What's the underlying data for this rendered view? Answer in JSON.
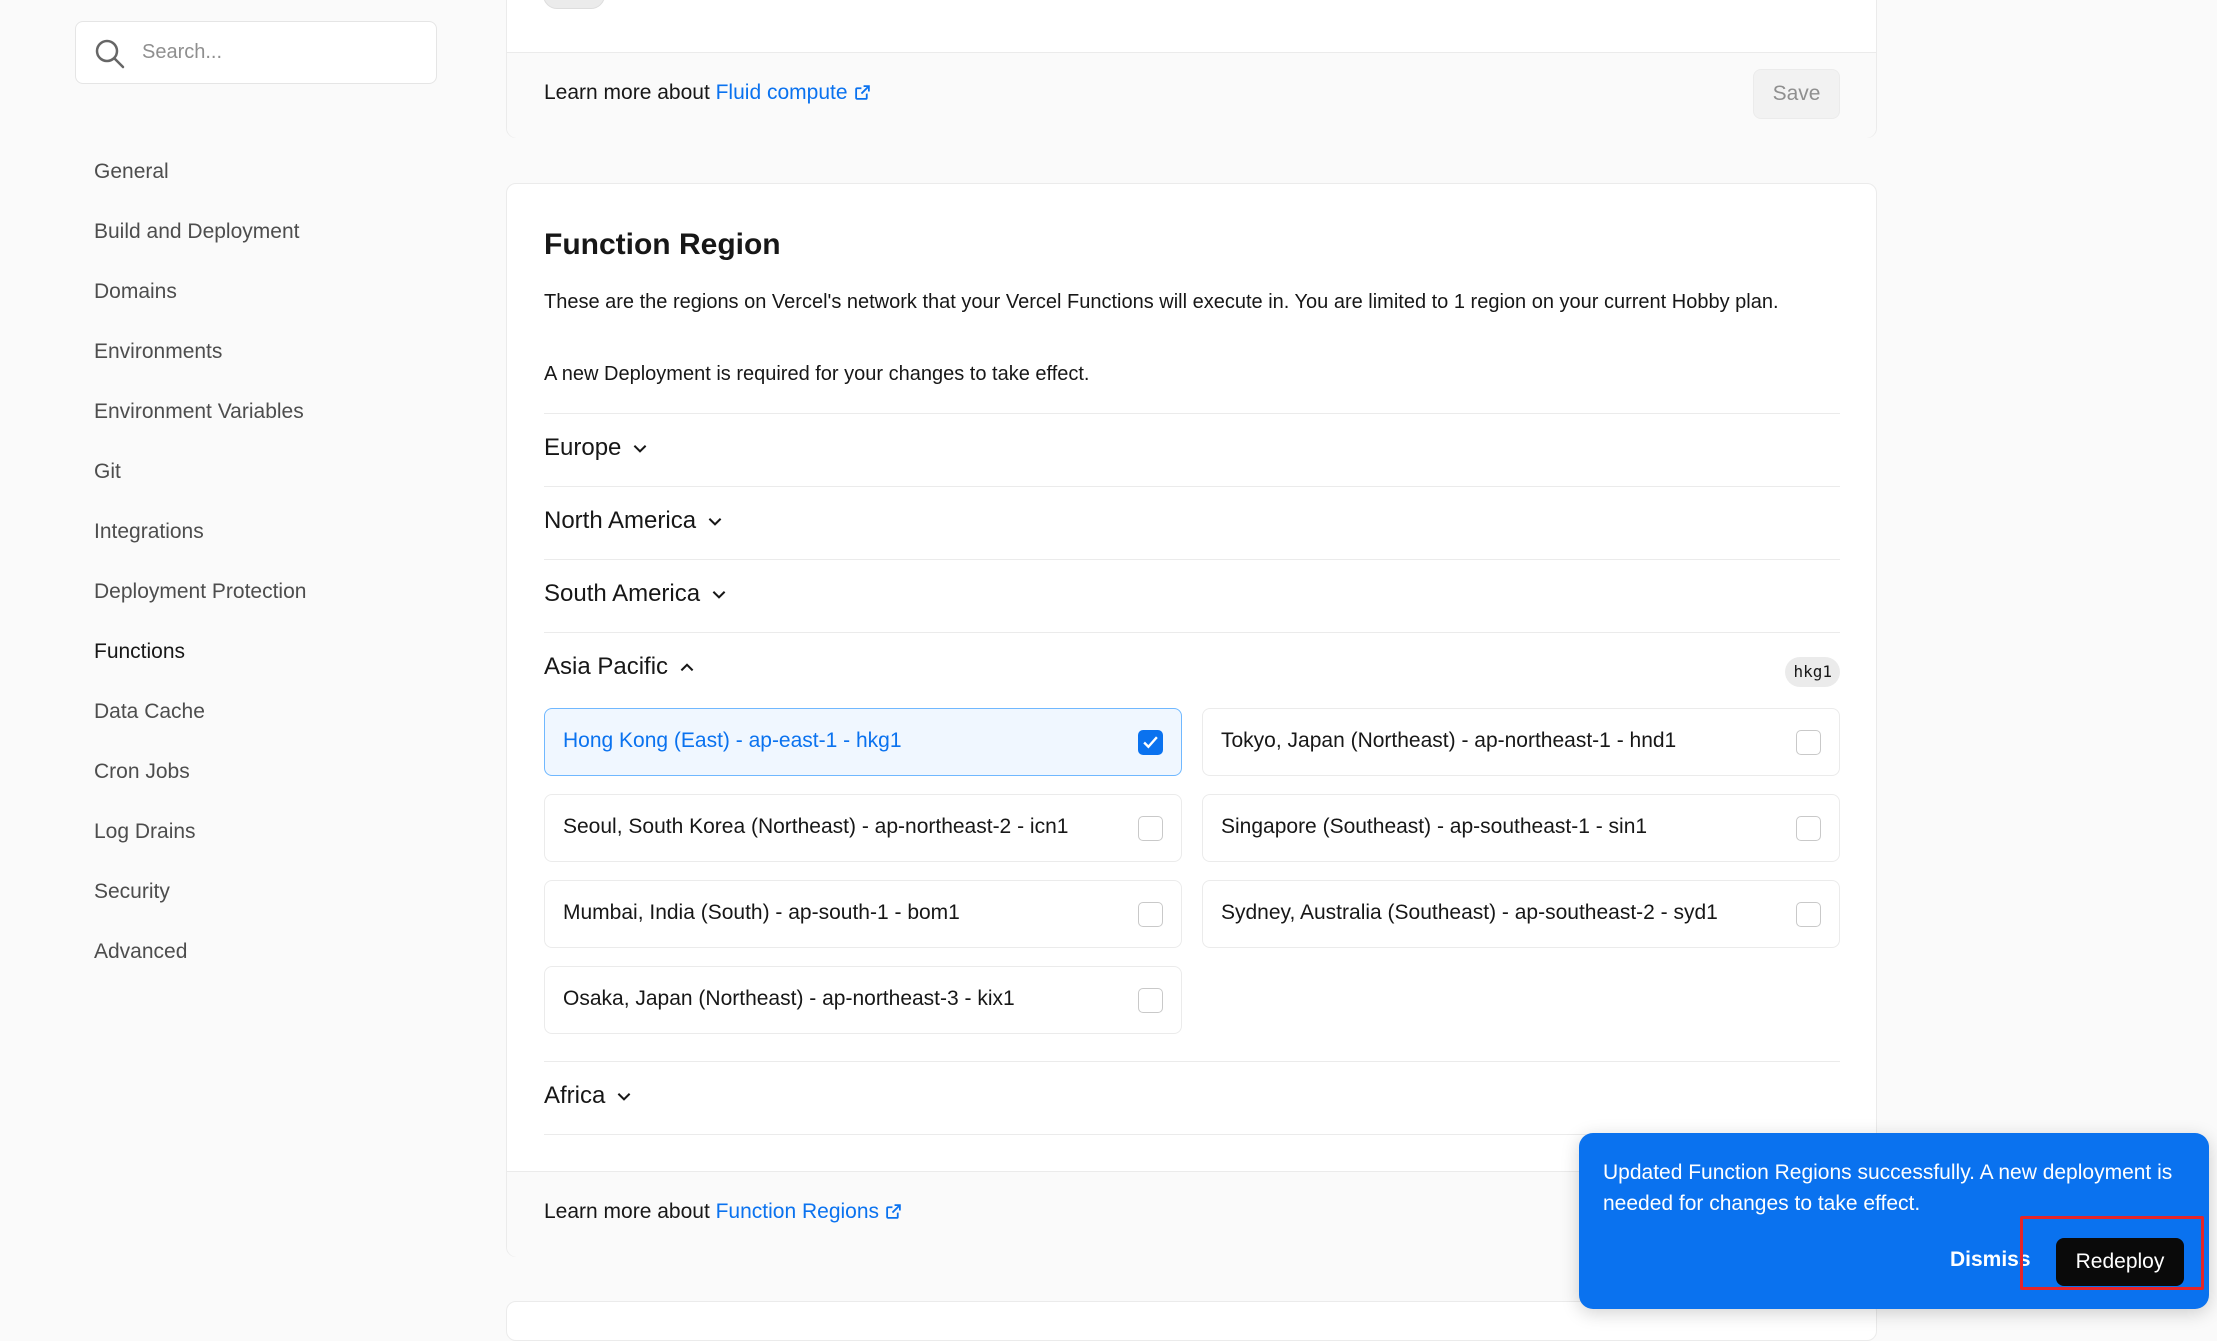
{
  "search": {
    "placeholder": "Search..."
  },
  "sidebar": {
    "items": [
      {
        "label": "General"
      },
      {
        "label": "Build and Deployment"
      },
      {
        "label": "Domains"
      },
      {
        "label": "Environments"
      },
      {
        "label": "Environment Variables"
      },
      {
        "label": "Git"
      },
      {
        "label": "Integrations"
      },
      {
        "label": "Deployment Protection"
      },
      {
        "label": "Functions",
        "active": true
      },
      {
        "label": "Data Cache"
      },
      {
        "label": "Cron Jobs"
      },
      {
        "label": "Log Drains"
      },
      {
        "label": "Security"
      },
      {
        "label": "Advanced"
      }
    ]
  },
  "fluid": {
    "learn_prefix": "Learn more about ",
    "link": "Fluid compute",
    "save_label": "Save"
  },
  "function_region": {
    "title": "Function Region",
    "description": "These are the regions on Vercel's network that your Vercel Functions will execute in. You are limited to 1 region on your current Hobby plan.",
    "note": "A new Deployment is required for your changes to take effect.",
    "groups": {
      "europe": "Europe",
      "north_america": "North America",
      "south_america": "South America",
      "asia_pacific": "Asia Pacific",
      "africa": "Africa"
    },
    "selected_badge": "hkg1",
    "asia_options": [
      {
        "label": "Hong Kong (East) - ap-east-1 - hkg1",
        "checked": true
      },
      {
        "label": "Tokyo, Japan (Northeast) - ap-northeast-1 - hnd1",
        "checked": false
      },
      {
        "label": "Seoul, South Korea (Northeast) - ap-northeast-2 - icn1",
        "checked": false
      },
      {
        "label": "Singapore (Southeast) - ap-southeast-1 - sin1",
        "checked": false
      },
      {
        "label": "Mumbai, India (South) - ap-south-1 - bom1",
        "checked": false
      },
      {
        "label": "Sydney, Australia (Southeast) - ap-southeast-2 - syd1",
        "checked": false
      },
      {
        "label": "Osaka, Japan (Northeast) - ap-northeast-3 - kix1",
        "checked": false
      }
    ],
    "learn_prefix": "Learn more about ",
    "link": "Function Regions"
  },
  "toast": {
    "message": "Updated Function Regions successfully. A new deployment is needed for changes to take effect.",
    "dismiss_label": "Dismiss",
    "redeploy_label": "Redeploy"
  },
  "colors": {
    "accent": "#0a72ef",
    "highlight": "#e5252a"
  }
}
